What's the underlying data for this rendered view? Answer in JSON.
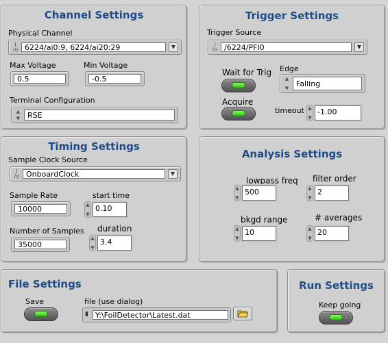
{
  "channel": {
    "title": "Channel Settings",
    "physical_channel_label": "Physical Channel",
    "physical_channel_value": "6224/ai0:9, 6224/ai20:29",
    "max_voltage_label": "Max Voltage",
    "max_voltage_value": "0.5",
    "min_voltage_label": "Min Voltage",
    "min_voltage_value": "-0.5",
    "terminal_config_label": "Terminal Configuration",
    "terminal_config_value": "RSE"
  },
  "trigger": {
    "title": "Trigger Settings",
    "source_label": "Trigger Source",
    "source_value": "/6224/PFI0",
    "wait_label": "Wait for Trig",
    "edge_label": "Edge",
    "edge_value": "Falling",
    "acquire_label": "Acquire",
    "timeout_label": "timeout",
    "timeout_value": "-1.00"
  },
  "timing": {
    "title": "Timing Settings",
    "clock_source_label": "Sample Clock Source",
    "clock_source_value": "OnboardClock",
    "sample_rate_label": "Sample Rate",
    "sample_rate_value": "10000",
    "start_time_label": "start time",
    "start_time_value": "0.10",
    "num_samples_label": "Number of Samples",
    "num_samples_value": "35000",
    "duration_label": "duration",
    "duration_value": "3.4"
  },
  "analysis": {
    "title": "Analysis Settings",
    "lowpass_label": "lowpass freq",
    "lowpass_value": "500",
    "filter_order_label": "filter order",
    "filter_order_value": "2",
    "bkgd_label": "bkgd range",
    "bkgd_value": "10",
    "averages_label": "# averages",
    "averages_value": "20"
  },
  "file": {
    "title": "File Settings",
    "save_label": "Save",
    "path_label": "file (use dialog)",
    "path_value": "Y:\\FoilDetector\\Latest.dat"
  },
  "run": {
    "title": "Run Settings",
    "keep_going_label": "Keep going"
  },
  "colors": {
    "title": "#1e4c8a",
    "panel": "#d0d0d0",
    "led_on": "#4fe02a"
  }
}
